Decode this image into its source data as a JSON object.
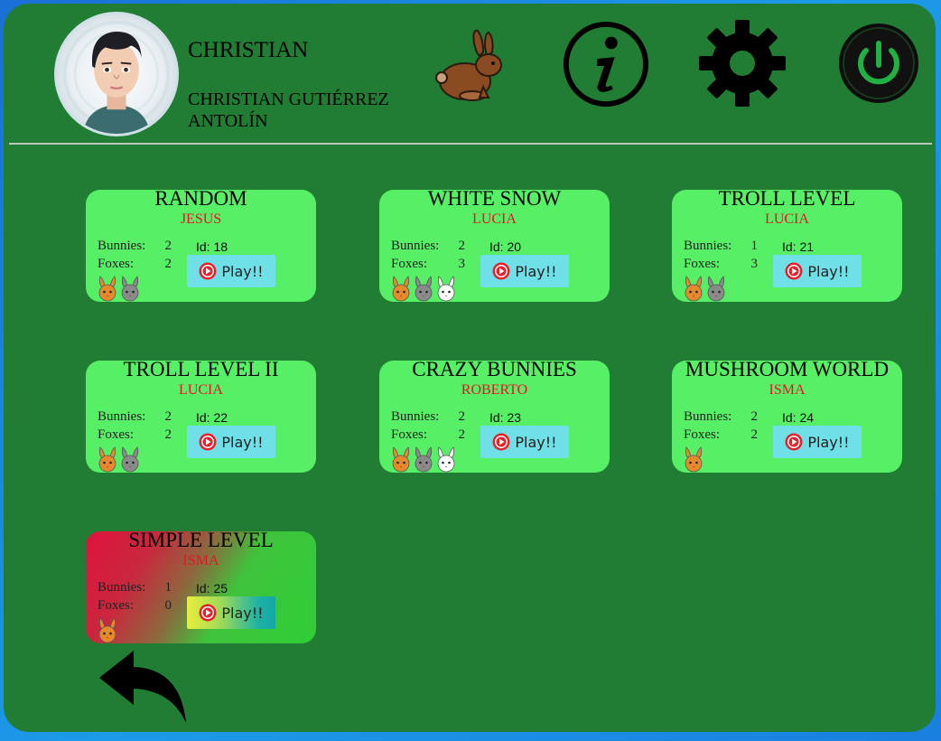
{
  "user": {
    "username": "CHRISTIAN",
    "full_name": "CHRISTIAN GUTIÉRREZ ANTOLÍN"
  },
  "header_icons": [
    "rabbit-icon",
    "info-icon",
    "gear-icon",
    "power-icon"
  ],
  "colors": {
    "background": "#217d33",
    "card": "#57ef66",
    "play_button": "#6fe0e8",
    "author_text": "#e8132a",
    "border": "#1c9be8"
  },
  "levels": [
    {
      "title": "RANDOM",
      "author": "JESUS",
      "bunnies_label": "Bunnies:",
      "bunnies": "2",
      "foxes_label": "Foxes:",
      "foxes": "2",
      "id_text": "Id: 18",
      "play_label": "Play!!",
      "bunny_colors": [
        "orange",
        "gray"
      ]
    },
    {
      "title": "WHITE SNOW",
      "author": "LUCIA",
      "bunnies_label": "Bunnies:",
      "bunnies": "2",
      "foxes_label": "Foxes:",
      "foxes": "3",
      "id_text": "Id: 20",
      "play_label": "Play!!",
      "bunny_colors": [
        "orange",
        "gray",
        "white"
      ]
    },
    {
      "title": "TROLL LEVEL",
      "author": "LUCIA",
      "bunnies_label": "Bunnies:",
      "bunnies": "1",
      "foxes_label": "Foxes:",
      "foxes": "3",
      "id_text": "Id: 21",
      "play_label": "Play!!",
      "bunny_colors": [
        "orange",
        "gray"
      ]
    },
    {
      "title": "TROLL LEVEL II",
      "author": "LUCIA",
      "bunnies_label": "Bunnies:",
      "bunnies": "2",
      "foxes_label": "Foxes:",
      "foxes": "2",
      "id_text": "Id: 22",
      "play_label": "Play!!",
      "bunny_colors": [
        "orange",
        "gray"
      ]
    },
    {
      "title": "CRAZY BUNNIES",
      "author": "ROBERTO",
      "bunnies_label": "Bunnies:",
      "bunnies": "2",
      "foxes_label": "Foxes:",
      "foxes": "2",
      "id_text": "Id: 23",
      "play_label": "Play!!",
      "bunny_colors": [
        "orange",
        "gray",
        "white"
      ]
    },
    {
      "title": "MUSHROOM WORLD",
      "author": "ISMA",
      "bunnies_label": "Bunnies:",
      "bunnies": "2",
      "foxes_label": "Foxes:",
      "foxes": "2",
      "id_text": "Id: 24",
      "play_label": "Play!!",
      "bunny_colors": [
        "orange"
      ]
    },
    {
      "title": "SIMPLE LEVEL",
      "author": "ISMA",
      "bunnies_label": "Bunnies:",
      "bunnies": "1",
      "foxes_label": "Foxes:",
      "foxes": "0",
      "id_text": "Id: 25",
      "play_label": "Play!!",
      "bunny_colors": [
        "orange"
      ],
      "highlighted": true
    }
  ]
}
